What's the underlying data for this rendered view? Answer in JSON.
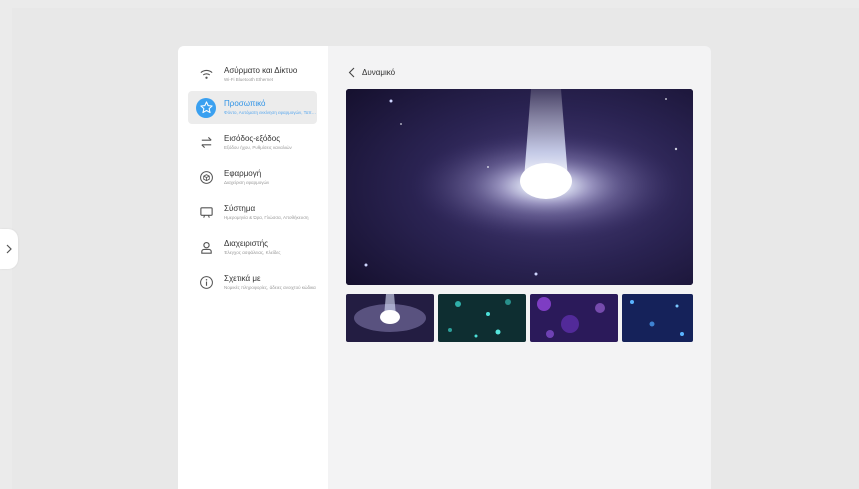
{
  "sidebar": {
    "items": [
      {
        "title": "Ασύρματο και Δίκτυο",
        "subtitle": "Wi-Fi Bluetooth Ethernet",
        "icon": "wifi-icon",
        "active": false
      },
      {
        "title": "Προσωπικό",
        "subtitle": "Φόντο, Αυτόματη εκκίνηση εφαρμογών, Ταπετσαρία",
        "icon": "star-icon",
        "active": true
      },
      {
        "title": "Εισόδος-εξόδος",
        "subtitle": "Εξόδου ήχου, Ρυθμίσεις καναλιών",
        "icon": "swap-icon",
        "active": false
      },
      {
        "title": "Εφαρμογή",
        "subtitle": "Διαχείριση εφαρμογών",
        "icon": "cube-icon",
        "active": false
      },
      {
        "title": "Σύστημα",
        "subtitle": "Ημερομηνία & Ώρα, Γλώσσα, Αποθήκευση",
        "icon": "monitor-icon",
        "active": false
      },
      {
        "title": "Διαχειριστής",
        "subtitle": "Έλεγχος ασφάλειας, Κλείδες",
        "icon": "user-icon",
        "active": false
      },
      {
        "title": "Σχετικά με",
        "subtitle": "Νομικές πληροφορίες, άδειες ανοιχτού κώδικα",
        "icon": "info-icon",
        "active": false
      }
    ]
  },
  "content": {
    "title": "Δυναμικό",
    "preview": "galaxy-wallpaper",
    "thumbnails": [
      "galaxy-wallpaper",
      "teal-particles-wallpaper",
      "purple-bokeh-wallpaper",
      "blue-particles-wallpaper"
    ]
  },
  "colors": {
    "accent": "#3aa0f0",
    "background": "#ebebeb",
    "panel": "#f3f3f4",
    "sidebar": "#ffffff"
  }
}
